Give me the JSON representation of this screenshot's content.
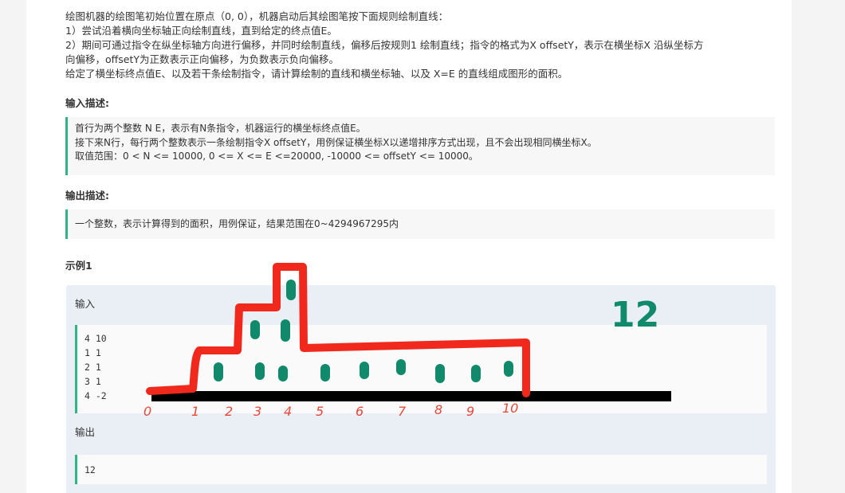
{
  "description": [
    "绘图机器的绘图笔初始位置在原点（0, 0），机器启动后其绘图笔按下面规则绘制直线：",
    "1）尝试沿着横向坐标轴正向绘制直线，直到给定的终点值E。",
    "2）期间可通过指令在纵坐标轴方向进行偏移，并同时绘制直线，偏移后按规则1 绘制直线；指令的格式为X offsetY，表示在横坐标X 沿纵坐标方",
    "向偏移，offsetY为正数表示正向偏移，为负数表示负向偏移。",
    "给定了横坐标终点值E、以及若干条绘制指令，请计算绘制的直线和横坐标轴、以及 X=E 的直线组成图形的面积。"
  ],
  "input_title": "输入描述:",
  "input_desc": [
    "首行为两个整数 N E，表示有N条指令，机器运行的横坐标终点值E。",
    "接下来N行，每行两个整数表示一条绘制指令X offsetY，用例保证横坐标X以递增排序方式出现，且不会出现相同横坐标X。",
    "取值范围：0 < N <= 10000, 0 <= X <= E <=20000, -10000 <= offsetY <= 10000。"
  ],
  "output_title": "输出描述:",
  "output_desc": "一个整数，表示计算得到的面积，用例保证，结果范围在0~4294967295内",
  "example_title": "示例1",
  "example": {
    "input_label": "输入",
    "input_lines": [
      "4 10",
      "1 1",
      "2 1",
      "3 1",
      "4 -2"
    ],
    "output_label": "输出",
    "output_value": "12"
  },
  "annotation": {
    "answer": "12",
    "axis_numbers": [
      "0",
      "1",
      "2",
      "3",
      "4",
      "5",
      "6",
      "7",
      "8",
      "9",
      "10"
    ],
    "colors": {
      "outline": "#f0291c",
      "dots": "#108a6a",
      "axis": "#000000",
      "numbers": "#e8473a"
    }
  }
}
